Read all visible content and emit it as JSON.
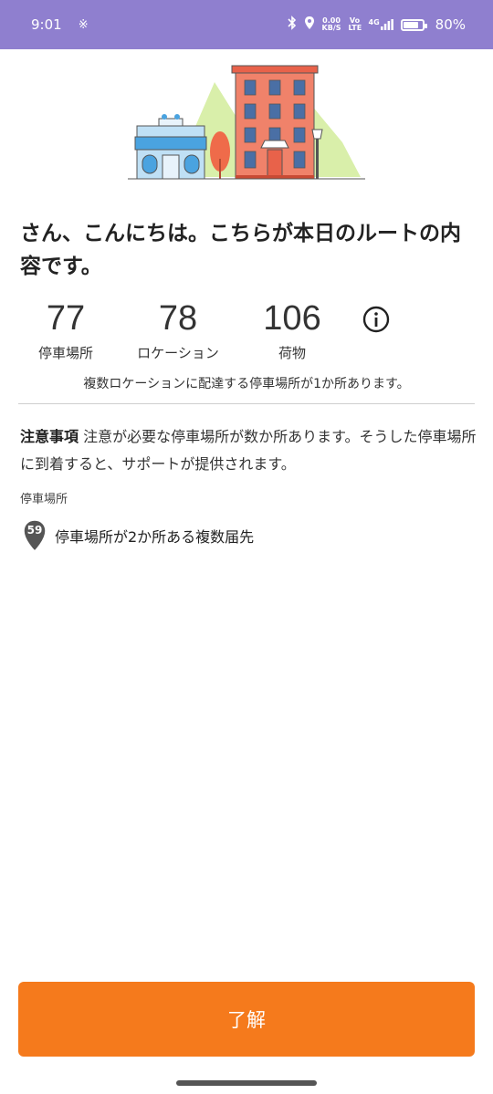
{
  "status_bar": {
    "time": "9:01",
    "network_speed": "0.00",
    "network_unit": "KB/S",
    "volte": "Vo LTE",
    "signal": "4G",
    "battery_percent": "80%",
    "battery_level": 0.8,
    "icons": [
      "notification-icon",
      "bluetooth-icon",
      "location-icon",
      "signal-icon",
      "battery-icon"
    ]
  },
  "greeting": "さん、こんにちは。こちらが本日のルートの内容です。",
  "stats": [
    {
      "value": "77",
      "label": "停車場所"
    },
    {
      "value": "78",
      "label": "ロケーション"
    },
    {
      "value": "106",
      "label": "荷物"
    }
  ],
  "multi_location_note": "複数ロケーションに配達する停車場所が1か所あります。",
  "notice": {
    "title": "注意事項",
    "body": "注意が必要な停車場所が数か所あります。そうした停車場所に到着すると、サポートが提供されます。"
  },
  "stops_section_label": "停車場所",
  "stop_item": {
    "number": "59",
    "text": "停車場所が2か所ある複数届先"
  },
  "button_label": "了解",
  "colors": {
    "status_bar": "#8f7fcf",
    "accent": "#f57a1c"
  }
}
